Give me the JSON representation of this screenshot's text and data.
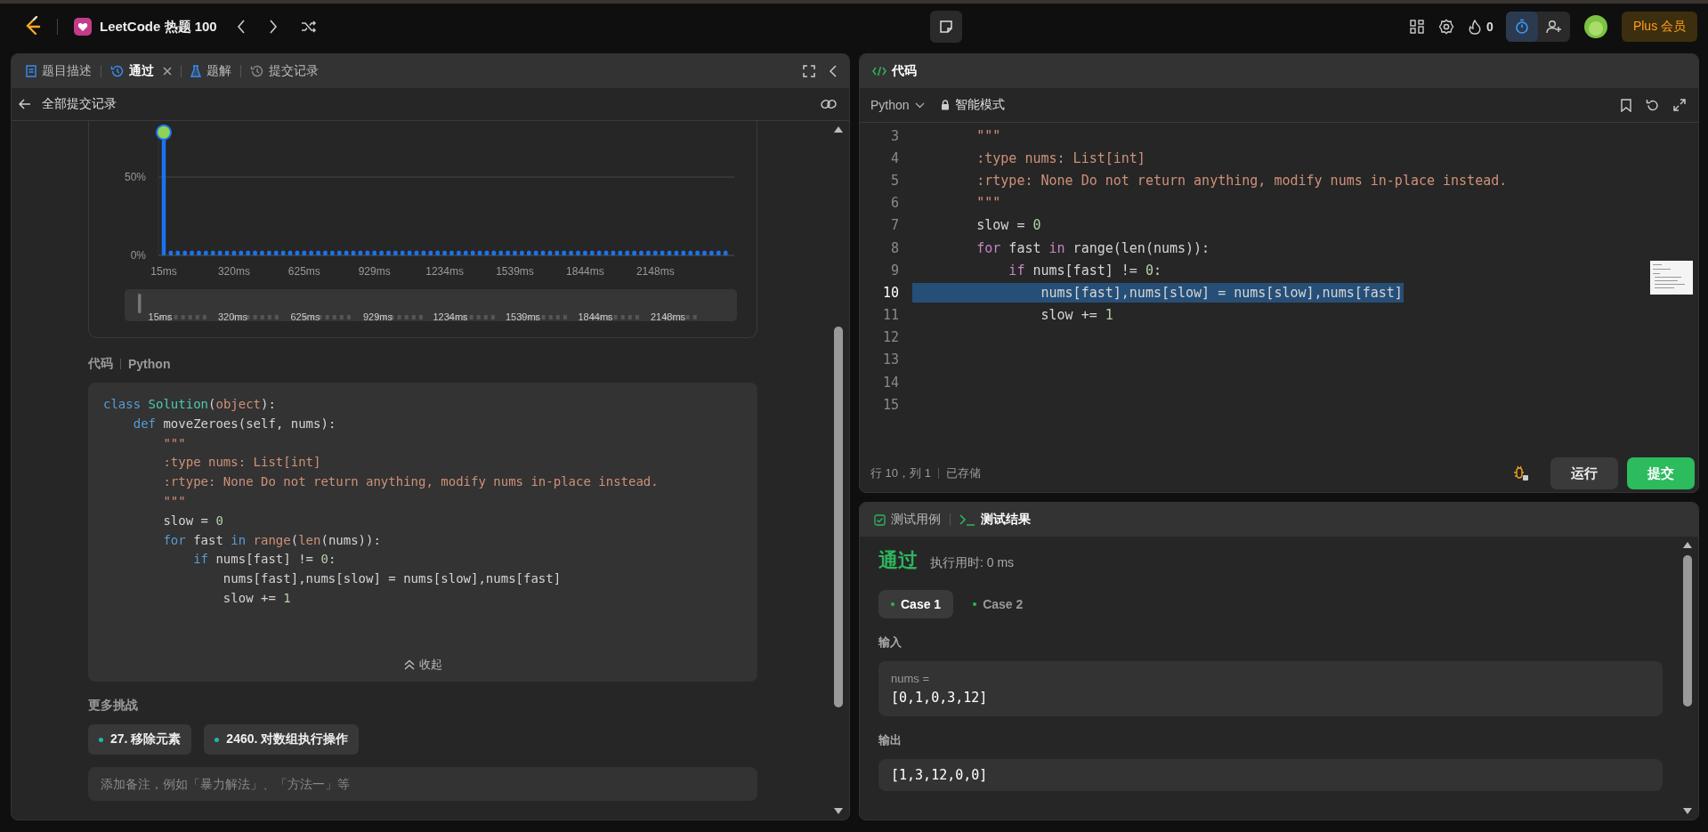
{
  "top_bar": {
    "title": "LeetCode 热题 100",
    "streak": "0",
    "timer_active": true,
    "plus_button": "Plus 会员"
  },
  "left_tabs": [
    {
      "label": "题目描述",
      "kind": "doc",
      "selected": false,
      "closable": false
    },
    {
      "label": "通过",
      "kind": "history",
      "selected": true,
      "closable": true
    },
    {
      "label": "题解",
      "kind": "flask",
      "selected": false,
      "closable": false
    },
    {
      "label": "提交记录",
      "kind": "history",
      "selected": false,
      "closable": false
    }
  ],
  "submission_header": {
    "back_label": "全部提交记录"
  },
  "chart": {
    "chart_data": {
      "type": "bar",
      "values": [
        74,
        3,
        3,
        3,
        3,
        3,
        3,
        3,
        3,
        3,
        3,
        3,
        3,
        3,
        3,
        3,
        3,
        3,
        3,
        3,
        3,
        3,
        3,
        3,
        3,
        3,
        3,
        3,
        3,
        3,
        3,
        3,
        3,
        3,
        3,
        3,
        3,
        3,
        3,
        3,
        3,
        3,
        3,
        3,
        3,
        3,
        3,
        3,
        3,
        3,
        3,
        3,
        3,
        3,
        3,
        3,
        3,
        3,
        3,
        3,
        3,
        3,
        3,
        3,
        3,
        3,
        3,
        3,
        3,
        3,
        3,
        3,
        3,
        3,
        3,
        3,
        3,
        3,
        3,
        3,
        3
      ],
      "categories": [
        "15ms",
        null,
        null,
        null,
        null,
        null,
        null,
        null,
        null,
        null,
        "320ms",
        null,
        null,
        null,
        null,
        null,
        null,
        null,
        null,
        null,
        "625ms",
        null,
        null,
        null,
        null,
        null,
        null,
        null,
        null,
        null,
        "929ms",
        null,
        null,
        null,
        null,
        null,
        null,
        null,
        null,
        null,
        "1234ms",
        null,
        null,
        null,
        null,
        null,
        null,
        null,
        null,
        null,
        "1539ms",
        null,
        null,
        null,
        null,
        null,
        null,
        null,
        null,
        null,
        "1844ms",
        null,
        null,
        null,
        null,
        null,
        null,
        null,
        null,
        null,
        "2148ms",
        null,
        null,
        null,
        null,
        null,
        null,
        null,
        null,
        null,
        null
      ],
      "ylim": [
        0,
        80
      ],
      "yticks": [
        {
          "value": 0,
          "label": "0%"
        },
        {
          "value": 50,
          "label": "50%"
        }
      ]
    },
    "range_labels": [
      "15ms",
      "320ms",
      "625ms",
      "929ms",
      "1234ms",
      "1539ms",
      "1844ms",
      "2148ms"
    ]
  },
  "code_section": {
    "label": "代码",
    "language": "Python",
    "collapse_label": "收起",
    "lines": [
      [
        {
          "t": "class",
          "kind": "kw"
        },
        {
          "t": " Solution",
          "kind": "cls"
        },
        {
          "t": "(",
          "kind": "pl"
        },
        {
          "t": "object",
          "kind": "bi"
        },
        {
          "t": "):",
          "kind": "pl"
        }
      ],
      [
        {
          "t": "    def",
          "kind": "kw"
        },
        {
          "t": " moveZeroes(self, nums):",
          "kind": "pl"
        }
      ],
      [
        {
          "t": "        \"\"\"",
          "kind": "str"
        }
      ],
      [
        {
          "t": "        :type nums: List[int]",
          "kind": "str"
        }
      ],
      [
        {
          "t": "        :rtype: None Do not return anything, modify nums in-place instead.",
          "kind": "str"
        }
      ],
      [
        {
          "t": "        \"\"\"",
          "kind": "str"
        }
      ],
      [
        {
          "t": "        slow = ",
          "kind": "pl"
        },
        {
          "t": "0",
          "kind": "num"
        }
      ],
      [
        {
          "t": "        for",
          "kind": "kw"
        },
        {
          "t": " fast ",
          "kind": "pl"
        },
        {
          "t": "in",
          "kind": "kw"
        },
        {
          "t": " range",
          "kind": "bi"
        },
        {
          "t": "(",
          "kind": "pl"
        },
        {
          "t": "len",
          "kind": "bi"
        },
        {
          "t": "(nums)):",
          "kind": "pl"
        }
      ],
      [
        {
          "t": "            if",
          "kind": "kw"
        },
        {
          "t": " nums[fast] != ",
          "kind": "pl"
        },
        {
          "t": "0",
          "kind": "num"
        },
        {
          "t": ":",
          "kind": "pl"
        }
      ],
      [
        {
          "t": "                nums[fast],nums[slow] = nums[slow],nums[fast]",
          "kind": "pl"
        }
      ],
      [
        {
          "t": "                slow += ",
          "kind": "pl"
        },
        {
          "t": "1",
          "kind": "num"
        }
      ]
    ]
  },
  "more_challenges": {
    "title": "更多挑战",
    "items": [
      "27. 移除元素",
      "2460. 对数组执行操作"
    ]
  },
  "note": {
    "placeholder": "添加备注，例如「暴力解法」、「方法一」等"
  },
  "editor": {
    "title": "代码",
    "language": "Python",
    "mode": "智能模式",
    "cursor": "行 10，列 1",
    "save_status": "已存储",
    "run_button": "运行",
    "submit_button": "提交",
    "lines": [
      {
        "n": "3",
        "selected": false,
        "tokens": [
          {
            "t": "        \"\"\"",
            "kind": "str"
          }
        ]
      },
      {
        "n": "4",
        "selected": false,
        "tokens": [
          {
            "t": "        :type nums: List[int]",
            "kind": "str"
          }
        ]
      },
      {
        "n": "5",
        "selected": false,
        "tokens": [
          {
            "t": "        :rtype: None Do not return anything, modify nums in-place instead.",
            "kind": "str"
          }
        ]
      },
      {
        "n": "6",
        "selected": false,
        "tokens": [
          {
            "t": "        \"\"\"",
            "kind": "str"
          }
        ]
      },
      {
        "n": "7",
        "selected": false,
        "tokens": [
          {
            "t": "        slow = ",
            "kind": "pl"
          },
          {
            "t": "0",
            "kind": "num"
          }
        ]
      },
      {
        "n": "8",
        "selected": false,
        "tokens": [
          {
            "t": "        for",
            "kind": "kw"
          },
          {
            "t": " fast ",
            "kind": "pl"
          },
          {
            "t": "in",
            "kind": "kw"
          },
          {
            "t": " range(len(nums)):",
            "kind": "pl"
          }
        ]
      },
      {
        "n": "9",
        "selected": false,
        "tokens": [
          {
            "t": "            if",
            "kind": "kw"
          },
          {
            "t": " nums[fast] != ",
            "kind": "pl"
          },
          {
            "t": "0",
            "kind": "num"
          },
          {
            "t": ":",
            "kind": "pl"
          }
        ]
      },
      {
        "n": "10",
        "selected": true,
        "tokens": [
          {
            "t": "                nums[fast],nums[slow] = nums[slow],nums[fast]",
            "kind": "pl"
          }
        ]
      },
      {
        "n": "11",
        "selected": false,
        "tokens": [
          {
            "t": "                slow += ",
            "kind": "pl"
          },
          {
            "t": "1",
            "kind": "num"
          }
        ]
      },
      {
        "n": "12",
        "selected": false
      },
      {
        "n": "13",
        "selected": false
      },
      {
        "n": "14",
        "selected": false
      },
      {
        "n": "15",
        "selected": false
      }
    ]
  },
  "results": {
    "tabs": [
      {
        "label": "测试用例",
        "kind": "check",
        "selected": false
      },
      {
        "label": "测试结果",
        "kind": "terminal",
        "selected": true
      }
    ],
    "status": "通过",
    "runtime": "执行用时: 0 ms",
    "cases": [
      {
        "label": "Case 1",
        "selected": true
      },
      {
        "label": "Case 2",
        "selected": false
      }
    ],
    "input_label": "输入",
    "inputs": [
      {
        "name": "nums =",
        "value": "[0,1,0,3,12]"
      }
    ],
    "output_label": "输出",
    "output": "[1,3,12,0,0]"
  }
}
